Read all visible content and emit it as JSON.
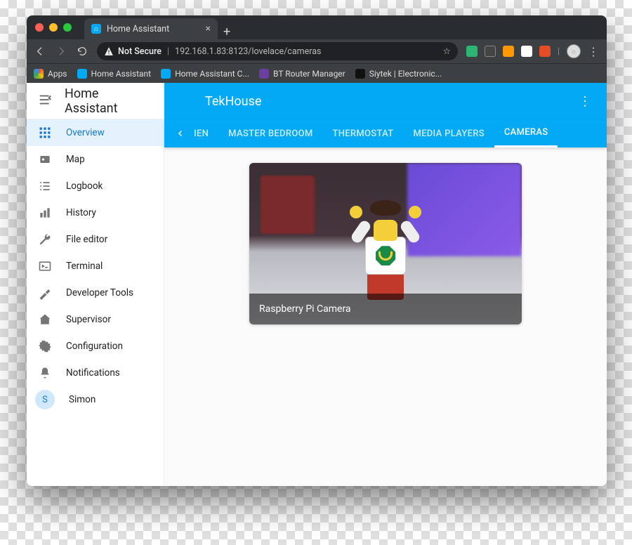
{
  "browser": {
    "tab_title": "Home Assistant",
    "security_label": "Not Secure",
    "url_display": "192.168.1.83:8123/lovelace/cameras",
    "bookmarks_bar": {
      "apps_label": "Apps",
      "items": [
        "Home Assistant",
        "Home Assistant C...",
        "BT Router Manager",
        "Siytek | Electronic..."
      ]
    },
    "ext_colors": [
      "#2bb673",
      "#d0d0d0",
      "#ff9800",
      "#ffffff",
      "#e44d26"
    ]
  },
  "sidebar": {
    "brand": "Home Assistant",
    "items": [
      {
        "label": "Overview",
        "icon": "grid",
        "active": true
      },
      {
        "label": "Map",
        "icon": "map",
        "active": false
      },
      {
        "label": "Logbook",
        "icon": "list",
        "active": false
      },
      {
        "label": "History",
        "icon": "chart",
        "active": false
      },
      {
        "label": "File editor",
        "icon": "wrench",
        "active": false
      },
      {
        "label": "Terminal",
        "icon": "terminal",
        "active": false
      },
      {
        "label": "Developer Tools",
        "icon": "hammer",
        "active": false
      },
      {
        "label": "Supervisor",
        "icon": "hass",
        "active": false
      },
      {
        "label": "Configuration",
        "icon": "gear",
        "active": false
      },
      {
        "label": "Notifications",
        "icon": "bell",
        "active": false
      }
    ],
    "user": {
      "label": "Simon",
      "initial": "S"
    }
  },
  "header": {
    "title": "TekHouse",
    "scroll_hint": "‹",
    "tabs": [
      {
        "label": "IEN",
        "active": false,
        "partial": true
      },
      {
        "label": "MASTER BEDROOM",
        "active": false
      },
      {
        "label": "THERMOSTAT",
        "active": false
      },
      {
        "label": "MEDIA PLAYERS",
        "active": false
      },
      {
        "label": "CAMERAS",
        "active": true
      }
    ]
  },
  "card": {
    "caption": "Raspberry Pi Camera"
  },
  "colors": {
    "primary": "#03a9f4",
    "sidebar_active": "#1976d2"
  }
}
